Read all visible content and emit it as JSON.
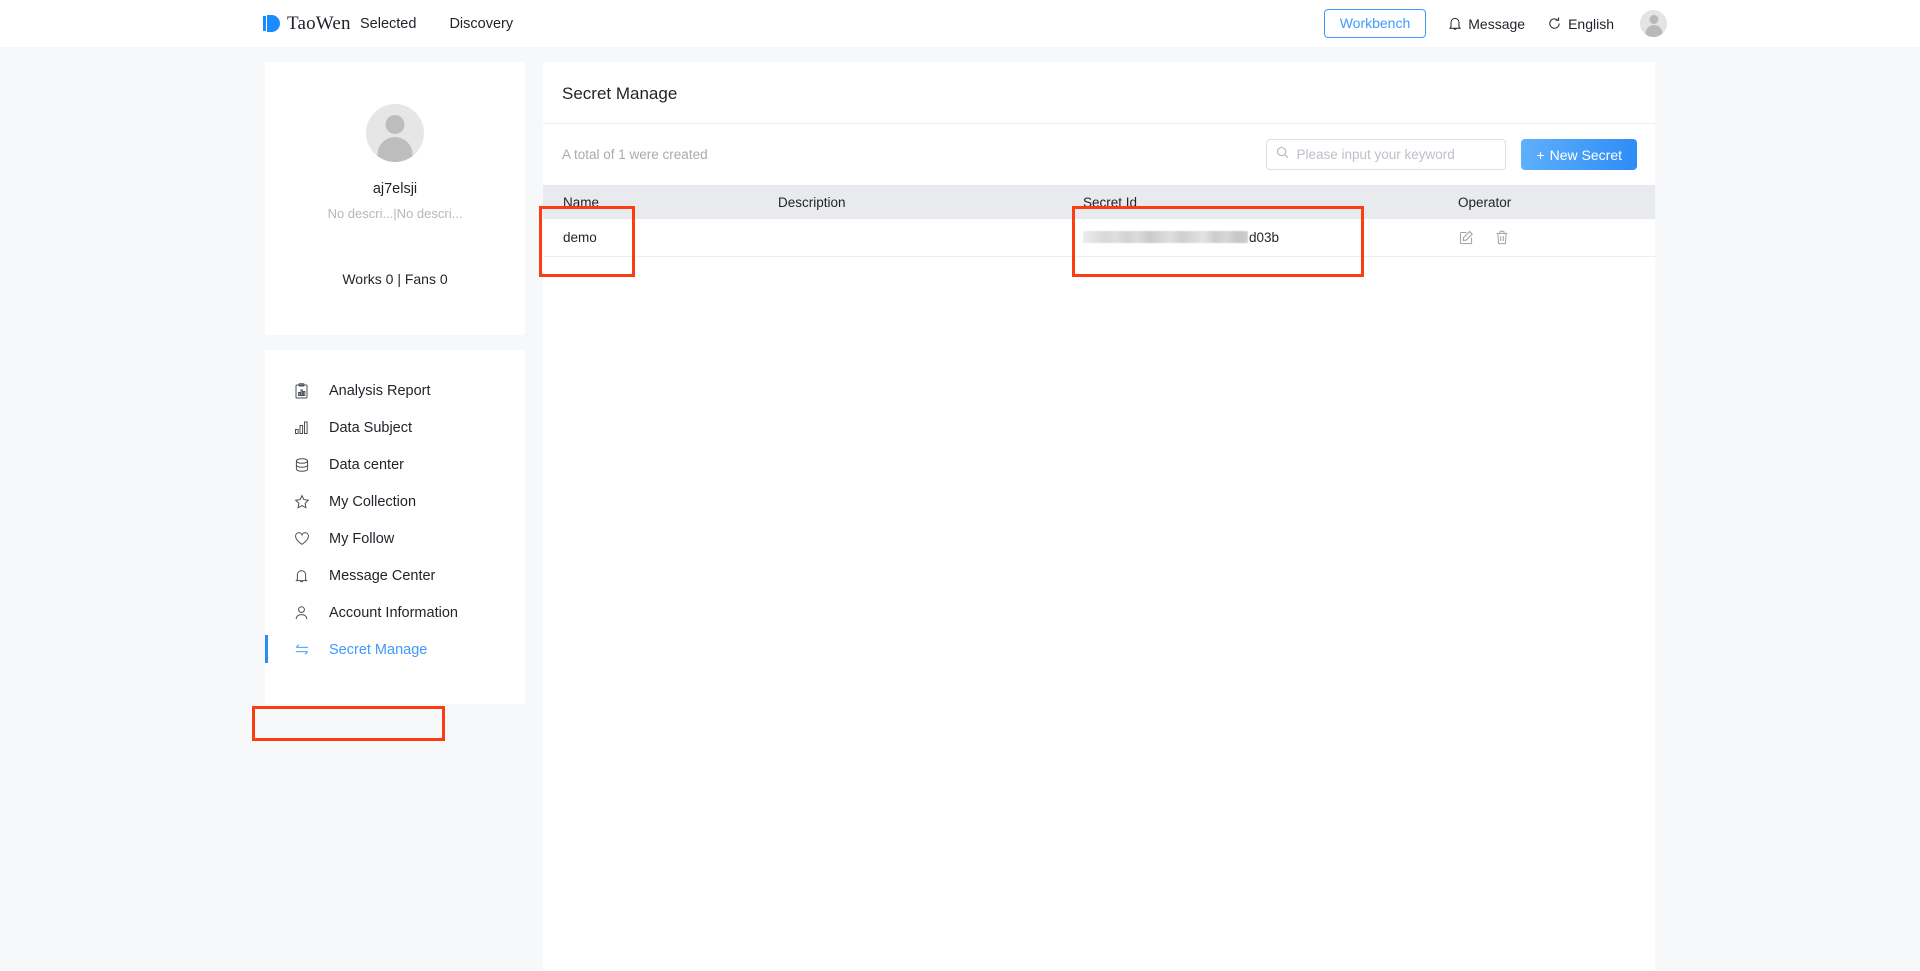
{
  "header": {
    "brand": "TaoWen",
    "nav": [
      {
        "label": "Selected"
      },
      {
        "label": "Discovery"
      }
    ],
    "workbench_label": "Workbench",
    "message_label": "Message",
    "language_label": "English",
    "accent_color": "#3d9bfc"
  },
  "sidebar": {
    "profile": {
      "name": "aj7elsji",
      "description": "No descri...|No descri...",
      "stats": "Works 0 | Fans 0"
    },
    "items": [
      {
        "label": "Analysis Report",
        "icon": "report-icon",
        "active": false
      },
      {
        "label": "Data Subject",
        "icon": "bar-chart-icon",
        "active": false
      },
      {
        "label": "Data center",
        "icon": "database-icon",
        "active": false
      },
      {
        "label": "My Collection",
        "icon": "star-icon",
        "active": false
      },
      {
        "label": "My Follow",
        "icon": "heart-icon",
        "active": false
      },
      {
        "label": "Message Center",
        "icon": "bell-icon",
        "active": false
      },
      {
        "label": "Account Information",
        "icon": "user-icon",
        "active": false
      },
      {
        "label": "Secret Manage",
        "icon": "exchange-icon",
        "active": true
      }
    ]
  },
  "main": {
    "title": "Secret Manage",
    "total_text": "A total of 1 were created",
    "search": {
      "placeholder": "Please input your keyword",
      "value": ""
    },
    "new_secret_label": "New Secret",
    "new_secret_plus": "+",
    "table": {
      "columns": [
        "Name",
        "Description",
        "Secret Id",
        "Operator"
      ],
      "rows": [
        {
          "name": "demo",
          "description": "",
          "secret_id_masked": "d03b",
          "operator_edit": "edit-icon",
          "operator_delete": "delete-icon"
        }
      ]
    }
  },
  "annotations": {
    "color": "#fc3d11",
    "boxes": [
      "sidebar-secret-manage",
      "table-name-column",
      "table-secret-id-column"
    ]
  }
}
